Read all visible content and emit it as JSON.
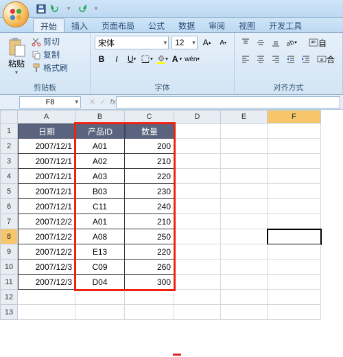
{
  "qat": {
    "save": "save-icon",
    "undo": "undo-icon",
    "redo": "redo-icon"
  },
  "tabs": [
    "开始",
    "插入",
    "页面布局",
    "公式",
    "数据",
    "审阅",
    "视图",
    "开发工具"
  ],
  "active_tab": 0,
  "ribbon": {
    "clipboard": {
      "paste": "粘贴",
      "cut": "剪切",
      "copy": "复制",
      "format_painter": "格式刷",
      "label": "剪贴板"
    },
    "font": {
      "name": "宋体",
      "size": "12",
      "label": "字体"
    },
    "align": {
      "label": "对齐方式",
      "wrap": "自",
      "merge": "合"
    }
  },
  "namebox": "F8",
  "fx_label": "fx",
  "columns": [
    "A",
    "B",
    "C",
    "D",
    "E",
    "F"
  ],
  "rows": [
    "1",
    "2",
    "3",
    "4",
    "5",
    "6",
    "7",
    "8",
    "9",
    "10",
    "11",
    "12",
    "13"
  ],
  "selected_row": 8,
  "selected_col": "F",
  "table": {
    "headers": [
      "日期",
      "产品ID",
      "数量"
    ],
    "rows": [
      [
        "2007/12/1",
        "A01",
        "200"
      ],
      [
        "2007/12/1",
        "A02",
        "210"
      ],
      [
        "2007/12/1",
        "A03",
        "220"
      ],
      [
        "2007/12/1",
        "B03",
        "230"
      ],
      [
        "2007/12/1",
        "C11",
        "240"
      ],
      [
        "2007/12/2",
        "A01",
        "210"
      ],
      [
        "2007/12/2",
        "A08",
        "250"
      ],
      [
        "2007/12/2",
        "E13",
        "220"
      ],
      [
        "2007/12/3",
        "C09",
        "260"
      ],
      [
        "2007/12/3",
        "D04",
        "300"
      ]
    ]
  },
  "chart_data": {
    "type": "table",
    "title": "",
    "columns": [
      "日期",
      "产品ID",
      "数量"
    ],
    "rows": [
      [
        "2007/12/1",
        "A01",
        200
      ],
      [
        "2007/12/1",
        "A02",
        210
      ],
      [
        "2007/12/1",
        "A03",
        220
      ],
      [
        "2007/12/1",
        "B03",
        230
      ],
      [
        "2007/12/1",
        "C11",
        240
      ],
      [
        "2007/12/2",
        "A01",
        210
      ],
      [
        "2007/12/2",
        "A08",
        250
      ],
      [
        "2007/12/2",
        "E13",
        220
      ],
      [
        "2007/12/3",
        "C09",
        260
      ],
      [
        "2007/12/3",
        "D04",
        300
      ]
    ]
  }
}
